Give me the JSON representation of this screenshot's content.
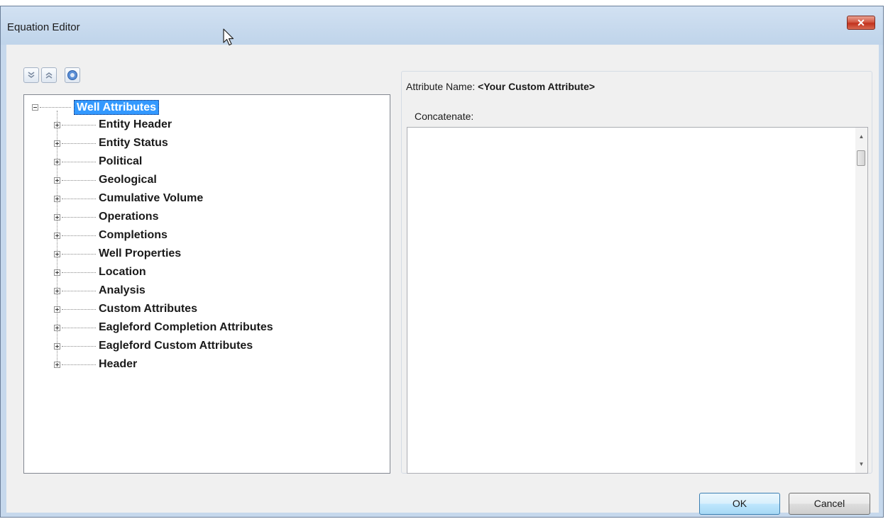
{
  "window": {
    "title": "Equation Editor",
    "close_label": "✕"
  },
  "toolbar": {
    "expand_all_icon": "double-chevron-down-icon",
    "collapse_all_icon": "double-chevron-up-icon",
    "help_icon": "help-icon"
  },
  "tree": {
    "root": "Well Attributes",
    "items": [
      {
        "label": "Entity Header"
      },
      {
        "label": "Entity Status"
      },
      {
        "label": "Political"
      },
      {
        "label": "Geological"
      },
      {
        "label": "Cumulative Volume"
      },
      {
        "label": "Operations"
      },
      {
        "label": "Completions"
      },
      {
        "label": "Well Properties"
      },
      {
        "label": "Location"
      },
      {
        "label": "Analysis"
      },
      {
        "label": "Custom Attributes"
      },
      {
        "label": "Eagleford Completion Attributes"
      },
      {
        "label": "Eagleford Custom Attributes"
      },
      {
        "label": "Header"
      }
    ]
  },
  "editor": {
    "attribute_name_label": "Attribute Name:",
    "attribute_name_value": "<Your Custom Attribute>",
    "concatenate_label": "Concatenate:",
    "text_value": ""
  },
  "buttons": {
    "ok": "OK",
    "cancel": "Cancel"
  },
  "colors": {
    "selection": "#3399ff",
    "titlebar": "#c6d8ec",
    "close": "#c2321d"
  }
}
